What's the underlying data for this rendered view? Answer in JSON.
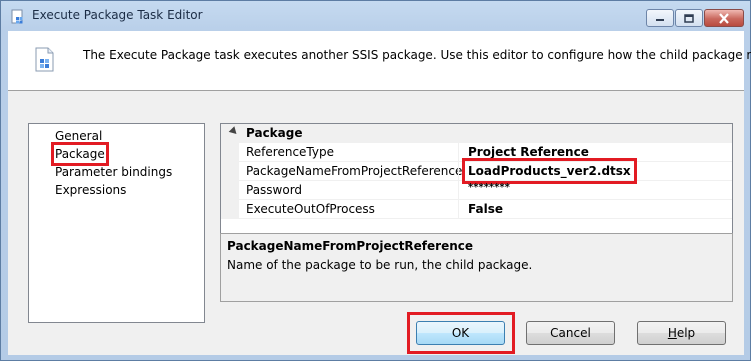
{
  "window": {
    "title": "Execute Package Task Editor"
  },
  "header": {
    "description": "The Execute Package task executes another SSIS package. Use this editor to configure how the child package runs."
  },
  "nav": {
    "items": [
      {
        "label": "General",
        "selected": false
      },
      {
        "label": "Package",
        "selected": true
      },
      {
        "label": "Parameter bindings",
        "selected": false
      },
      {
        "label": "Expressions",
        "selected": false
      }
    ]
  },
  "grid": {
    "category": "Package",
    "properties": [
      {
        "name": "ReferenceType",
        "value": "Project Reference"
      },
      {
        "name": "PackageNameFromProjectReference",
        "value": "LoadProducts_ver2.dtsx"
      },
      {
        "name": "Password",
        "value": "********"
      },
      {
        "name": "ExecuteOutOfProcess",
        "value": "False"
      }
    ]
  },
  "description_pane": {
    "title": "PackageNameFromProjectReference",
    "text": "Name of the package to be run, the child package."
  },
  "buttons": {
    "ok": "OK",
    "cancel": "Cancel",
    "help_prefix": "",
    "help_underlined": "H",
    "help_rest": "elp"
  },
  "colors": {
    "highlight": "#e21b23",
    "title_bg": "#c5daf0",
    "dialog_bg": "#f0f0f0"
  },
  "icons": {
    "title": "package-task-icon",
    "header": "package-task-icon",
    "minimize": "minimize-icon",
    "maximize": "maximize-icon",
    "close": "close-icon",
    "category_toggle": "expand-collapse-icon"
  }
}
